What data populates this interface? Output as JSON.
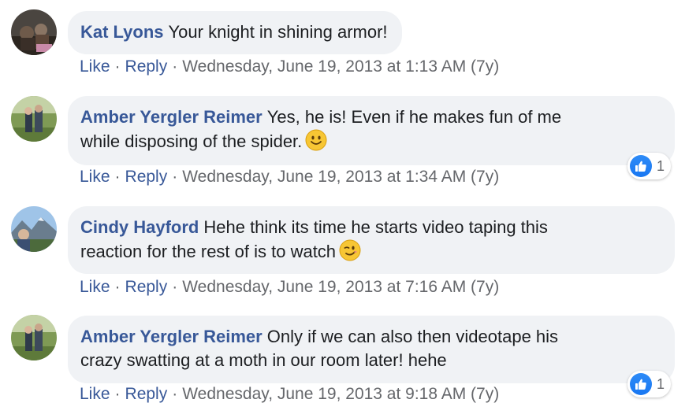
{
  "comments": [
    {
      "author": "Kat Lyons",
      "text": "Your knight in shining armor!",
      "like_label": "Like",
      "reply_label": "Reply",
      "separator": "·",
      "timestamp": "Wednesday, June 19, 2013 at 1:13 AM (7y)",
      "avatar_icon": "profile-photo-dark"
    },
    {
      "author": "Amber Yergler Reimer",
      "text_line1": "Yes, he is! Even if he makes fun of me",
      "text_line2": "while disposing of the spider.",
      "emoji": "smiling-face-emoji",
      "like_label": "Like",
      "reply_label": "Reply",
      "separator": "·",
      "timestamp": "Wednesday, June 19, 2013 at 1:34 AM (7y)",
      "reaction_count": "1",
      "reaction_icon": "like-thumb-icon",
      "avatar_icon": "profile-photo-trail"
    },
    {
      "author": "Cindy Hayford",
      "text_line1": "Hehe think its time he starts video taping this",
      "text_line2": "reaction for the rest of is to watch",
      "emoji": "winking-face-emoji",
      "like_label": "Like",
      "reply_label": "Reply",
      "separator": "·",
      "timestamp": "Wednesday, June 19, 2013 at 7:16 AM (7y)",
      "avatar_icon": "profile-photo-mountains"
    },
    {
      "author": "Amber Yergler Reimer",
      "text_line1": "Only if we can also then videotape his",
      "text_line2": "crazy swatting at a moth in our room later! hehe",
      "like_label": "Like",
      "reply_label": "Reply",
      "separator": "·",
      "timestamp": "Wednesday, June 19, 2013 at 9:18 AM (7y)",
      "reaction_count": "1",
      "reaction_icon": "like-thumb-icon",
      "avatar_icon": "profile-photo-trail"
    }
  ],
  "colors": {
    "author": "#385898",
    "bubble": "#f0f2f5",
    "meta": "#65676b",
    "like_blue": "#1877f2"
  }
}
